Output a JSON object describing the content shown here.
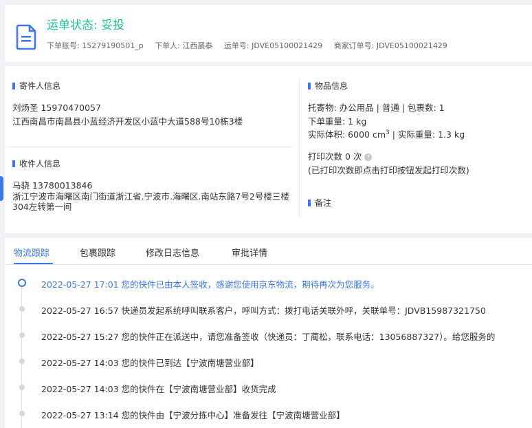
{
  "header": {
    "status_title": "运单状态: 妥投",
    "meta": [
      {
        "label": "下单账号:",
        "value": "15279190501_p"
      },
      {
        "label": "下单人:",
        "value": "江西晨泰"
      },
      {
        "label": "运单号:",
        "value": "JDVE05100021429"
      },
      {
        "label": "商家订单号:",
        "value": "JDVE05100021429"
      }
    ]
  },
  "sender": {
    "title": "寄件人信息",
    "name_phone": "刘炀圣   15970470057",
    "address": "江西南昌市南昌县小蓝经济开发区小蓝中大道588号10栋3楼"
  },
  "receiver": {
    "title": "收件人信息",
    "name_phone": "马骁   13780013846",
    "address": "浙江宁波市海曙区南门街道浙江省.宁波市.海曙区.南站东路7号2号楼三楼304左转第一间"
  },
  "goods": {
    "title": "物品信息",
    "line1": "托寄物:  办公用品 | 普通  |  包裹数:  1",
    "line2": "下单重量:  1 kg",
    "line3_a": "实际体积:   6000 cm",
    "line3_sup": "3",
    "line3_b": " | 实际重量:   1.3 kg",
    "print_count": "打印次数    0 次",
    "print_help_icon": "?",
    "print_note": "(已打印次数即点击打印按钮发起打印次数)",
    "remark_title": "备注"
  },
  "tabs": [
    "物流跟踪",
    "包裹跟踪",
    "修改日志信息",
    "审批详情"
  ],
  "tracking": [
    {
      "text": "2022-05-27 17:01 您的快件已由本人签收，感谢您使用京东物流，期待再次为您服务。",
      "current": true
    },
    {
      "text": "2022-05-27 16:57 快递员发起系统呼叫联系客户，呼叫方式：拨打电话关联外呼，关联单号：JDVB15987321750",
      "current": false
    },
    {
      "text": "2022-05-27 15:27 您的快件正在派送中，请您准备签收（快递员：丁蔺松，联系电话：13056887327）。给您服务的",
      "current": false
    },
    {
      "text": "2022-05-27 14:03 您的快件已到达【宁波南塘营业部】",
      "current": false
    },
    {
      "text": "2022-05-27 14:03 您的快件在【宁波南塘营业部】收货完成",
      "current": false
    },
    {
      "text": "2022-05-27 13:14 您的快件由【宁波分拣中心】准备发往【宁波南塘营业部】",
      "current": false
    }
  ],
  "colors": {
    "accent": "#3d78e6",
    "status": "#1fbf9f"
  },
  "icons": {
    "header": "document-icon"
  }
}
